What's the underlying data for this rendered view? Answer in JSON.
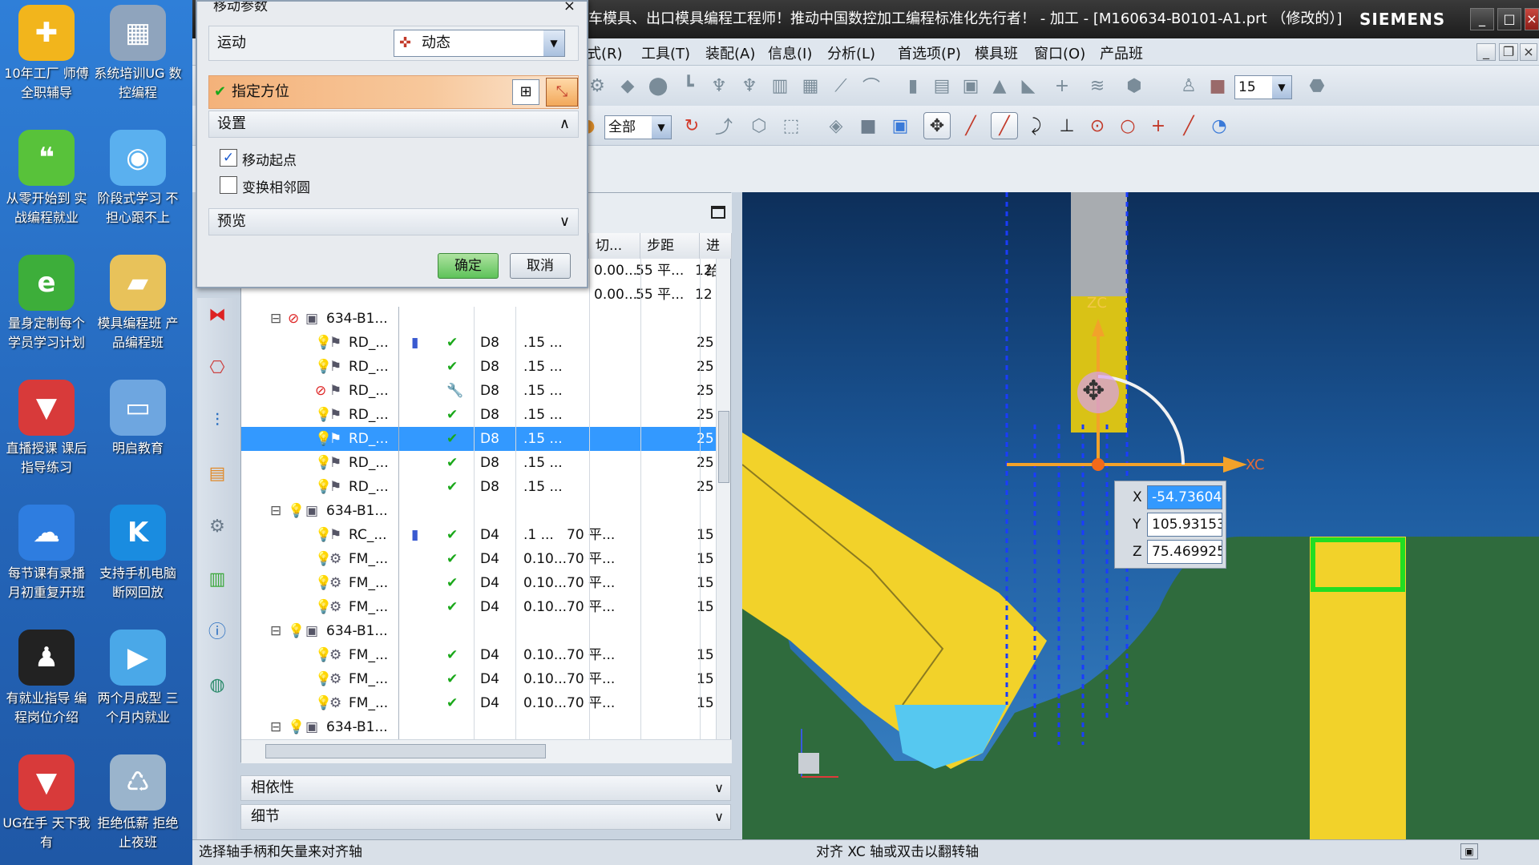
{
  "desktop": {
    "icons": [
      {
        "label": "10年工厂 师傅全职辅导",
        "icon": "plus-icon",
        "color": "#f2b51c"
      },
      {
        "label": "系统培训UG 数控编程",
        "icon": "calculator-icon",
        "color": "#8fa4bd"
      },
      {
        "label": "从零开始到 实战编程就业",
        "icon": "wechat-icon",
        "color": "#58c23a"
      },
      {
        "label": "阶段式学习 不担心跟不上",
        "icon": "qq-bubble-icon",
        "color": "#5ab0ef"
      },
      {
        "label": "量身定制每个 学员学习计划",
        "icon": "ie-browser-icon",
        "color": "#3dae3a"
      },
      {
        "label": "模具编程班 产品编程班",
        "icon": "folder-icon",
        "color": "#e8c25a"
      },
      {
        "label": "直播授课 课后指导练习",
        "icon": "ug-logo-icon",
        "color": "#d83a3a"
      },
      {
        "label": "明启教育",
        "icon": "monitor-icon",
        "color": "#6ea6e0"
      },
      {
        "label": "每节课有录播 月初重复开班",
        "icon": "baidu-cloud-icon",
        "color": "#2e7de0"
      },
      {
        "label": "支持手机电脑 断网回放",
        "icon": "k-player-icon",
        "color": "#1a8ce0"
      },
      {
        "label": "有就业指导 编程岗位介绍",
        "icon": "qq-penguin-icon",
        "color": "#222222"
      },
      {
        "label": "两个月成型 三个月内就业",
        "icon": "play-icon",
        "color": "#4aa8e8"
      },
      {
        "label": "UG在手 天下我有",
        "icon": "ug-logo-icon",
        "color": "#d83a3a"
      },
      {
        "label": "拒绝低薪 拒绝止夜班",
        "icon": "recycle-bin-icon",
        "color": "#9ab4cc"
      }
    ]
  },
  "window": {
    "title": "车模具、出口模具编程工程师！推动中国数控加工编程标准化先行者！ - 加工 - [M160634-B0101-A1.prt （修改的）]",
    "brand": "SIEMENS"
  },
  "menu": [
    "式(R)",
    "工具(T)",
    "装配(A)",
    "信息(I)",
    "分析(L)",
    "首选项(P)",
    "模具班",
    "窗口(O)",
    "产品班"
  ],
  "toolbar": {
    "filter_select": "全部",
    "number_select": "15"
  },
  "dialog": {
    "title": "移动参数",
    "motion_label": "运动",
    "motion_value": "动态",
    "specify_orientation": "指定方位",
    "settings_header": "设置",
    "move_origin_label": "移动起点",
    "move_origin_checked": true,
    "swap_adjacent_label": "变换相邻圆",
    "swap_adjacent_checked": false,
    "preview_header": "预览",
    "ok": "确定",
    "cancel": "取消"
  },
  "navigator": {
    "columns": [
      "切...",
      "步距",
      "进给"
    ],
    "top_rows": [
      {
        "cut": "0.00...",
        "step": "55 平...",
        "feed": "12"
      },
      {
        "cut": "0.00...",
        "step": "55 平...",
        "feed": "12"
      }
    ],
    "rows": [
      {
        "level": 0,
        "status": "prohibit",
        "kind": "group",
        "name": "634-B1...",
        "tool": "",
        "cut": "",
        "step": "",
        "feed": ""
      },
      {
        "level": 1,
        "status": "bulb",
        "kind": "op",
        "name": "RD_...",
        "tool": "D8",
        "cut": ".15 ...",
        "step": "",
        "feed": "25",
        "check": "ok",
        "extra": true
      },
      {
        "level": 1,
        "status": "bulb",
        "kind": "op",
        "name": "RD_...",
        "tool": "D8",
        "cut": ".15 ...",
        "step": "",
        "feed": "25",
        "check": "ok"
      },
      {
        "level": 1,
        "status": "prohibit",
        "kind": "op",
        "name": "RD_...",
        "tool": "D8",
        "cut": ".15 ...",
        "step": "",
        "feed": "25",
        "check": "wrench"
      },
      {
        "level": 1,
        "status": "bulb",
        "kind": "op",
        "name": "RD_...",
        "tool": "D8",
        "cut": ".15 ...",
        "step": "",
        "feed": "25",
        "check": "ok"
      },
      {
        "level": 1,
        "status": "bulb",
        "kind": "op",
        "name": "RD_...",
        "tool": "D8",
        "cut": ".15 ...",
        "step": "",
        "feed": "25",
        "check": "ok",
        "selected": true
      },
      {
        "level": 1,
        "status": "bulb",
        "kind": "op",
        "name": "RD_...",
        "tool": "D8",
        "cut": ".15 ...",
        "step": "",
        "feed": "25",
        "check": "ok"
      },
      {
        "level": 1,
        "status": "bulb",
        "kind": "op",
        "name": "RD_...",
        "tool": "D8",
        "cut": ".15 ...",
        "step": "",
        "feed": "25",
        "check": "ok"
      },
      {
        "level": 0,
        "status": "bulb",
        "kind": "group",
        "name": "634-B1...",
        "tool": "",
        "cut": "",
        "step": "",
        "feed": ""
      },
      {
        "level": 1,
        "status": "bulb",
        "kind": "op",
        "name": "RC_...",
        "tool": "D4",
        "cut": ".1 ...",
        "step": "70 平...",
        "feed": "15",
        "check": "ok",
        "extra": true
      },
      {
        "level": 1,
        "status": "bulb",
        "kind": "op2",
        "name": "FM_...",
        "tool": "D4",
        "cut": "0.10...",
        "step": "70 平...",
        "feed": "15",
        "check": "ok"
      },
      {
        "level": 1,
        "status": "bulb",
        "kind": "op2",
        "name": "FM_...",
        "tool": "D4",
        "cut": "0.10...",
        "step": "70 平...",
        "feed": "15",
        "check": "ok"
      },
      {
        "level": 1,
        "status": "bulb",
        "kind": "op2",
        "name": "FM_...",
        "tool": "D4",
        "cut": "0.10...",
        "step": "70 平...",
        "feed": "15",
        "check": "ok"
      },
      {
        "level": 0,
        "status": "bulb",
        "kind": "group",
        "name": "634-B1...",
        "tool": "",
        "cut": "",
        "step": "",
        "feed": ""
      },
      {
        "level": 1,
        "status": "bulb",
        "kind": "op2",
        "name": "FM_...",
        "tool": "D4",
        "cut": "0.10...",
        "step": "70 平...",
        "feed": "15",
        "check": "ok"
      },
      {
        "level": 1,
        "status": "bulb",
        "kind": "op2",
        "name": "FM_...",
        "tool": "D4",
        "cut": "0.10...",
        "step": "70 平...",
        "feed": "15",
        "check": "ok"
      },
      {
        "level": 1,
        "status": "bulb",
        "kind": "op2",
        "name": "FM_...",
        "tool": "D4",
        "cut": "0.10...",
        "step": "70 平...",
        "feed": "15",
        "check": "ok"
      },
      {
        "level": 0,
        "status": "bulb",
        "kind": "group",
        "name": "634-B1...",
        "tool": "",
        "cut": "",
        "step": "",
        "feed": ""
      }
    ],
    "dependency": "相依性",
    "details": "细节"
  },
  "graphics": {
    "axis_zc": "ZC",
    "axis_xc": "XC",
    "x_label": "X",
    "y_label": "Y",
    "z_label": "Z",
    "x_value": "-54.73604",
    "y_value": "105.93153",
    "z_value": "75.469925"
  },
  "status": {
    "left": "选择轴手柄和矢量来对齐轴",
    "center": "对齐 XC 轴或双击以翻转轴"
  },
  "colors": {
    "selection": "#3399ff",
    "dialog_highlight": "#f4b27a",
    "ok_green": "#1aa81a",
    "model_green": "#2f6b3d",
    "model_yellow": "#f2d22a"
  }
}
